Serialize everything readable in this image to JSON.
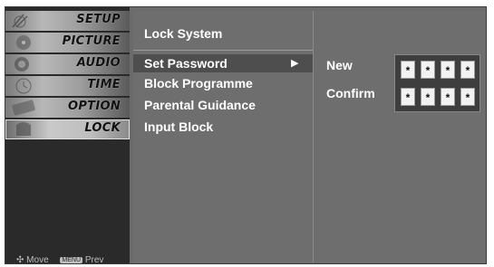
{
  "left_menu": {
    "items": [
      {
        "label": "SETUP"
      },
      {
        "label": "PICTURE"
      },
      {
        "label": "AUDIO"
      },
      {
        "label": "TIME"
      },
      {
        "label": "OPTION"
      },
      {
        "label": "LOCK"
      }
    ],
    "selected_index": 5
  },
  "help": {
    "move_label": "Move",
    "menu_key": "MENU",
    "prev_label": "Prev"
  },
  "lock_menu": {
    "title": "Lock System",
    "options": [
      {
        "label": "Set Password"
      },
      {
        "label": "Block Programme"
      },
      {
        "label": "Parental Guidance"
      },
      {
        "label": "Input Block"
      }
    ],
    "selected_index": 0,
    "arrow_glyph": "▶"
  },
  "password": {
    "new_label": "New",
    "confirm_label": "Confirm",
    "new_digits": [
      "*",
      "*",
      "*",
      "*"
    ],
    "confirm_digits": [
      "*",
      "*",
      "*",
      "*"
    ]
  }
}
